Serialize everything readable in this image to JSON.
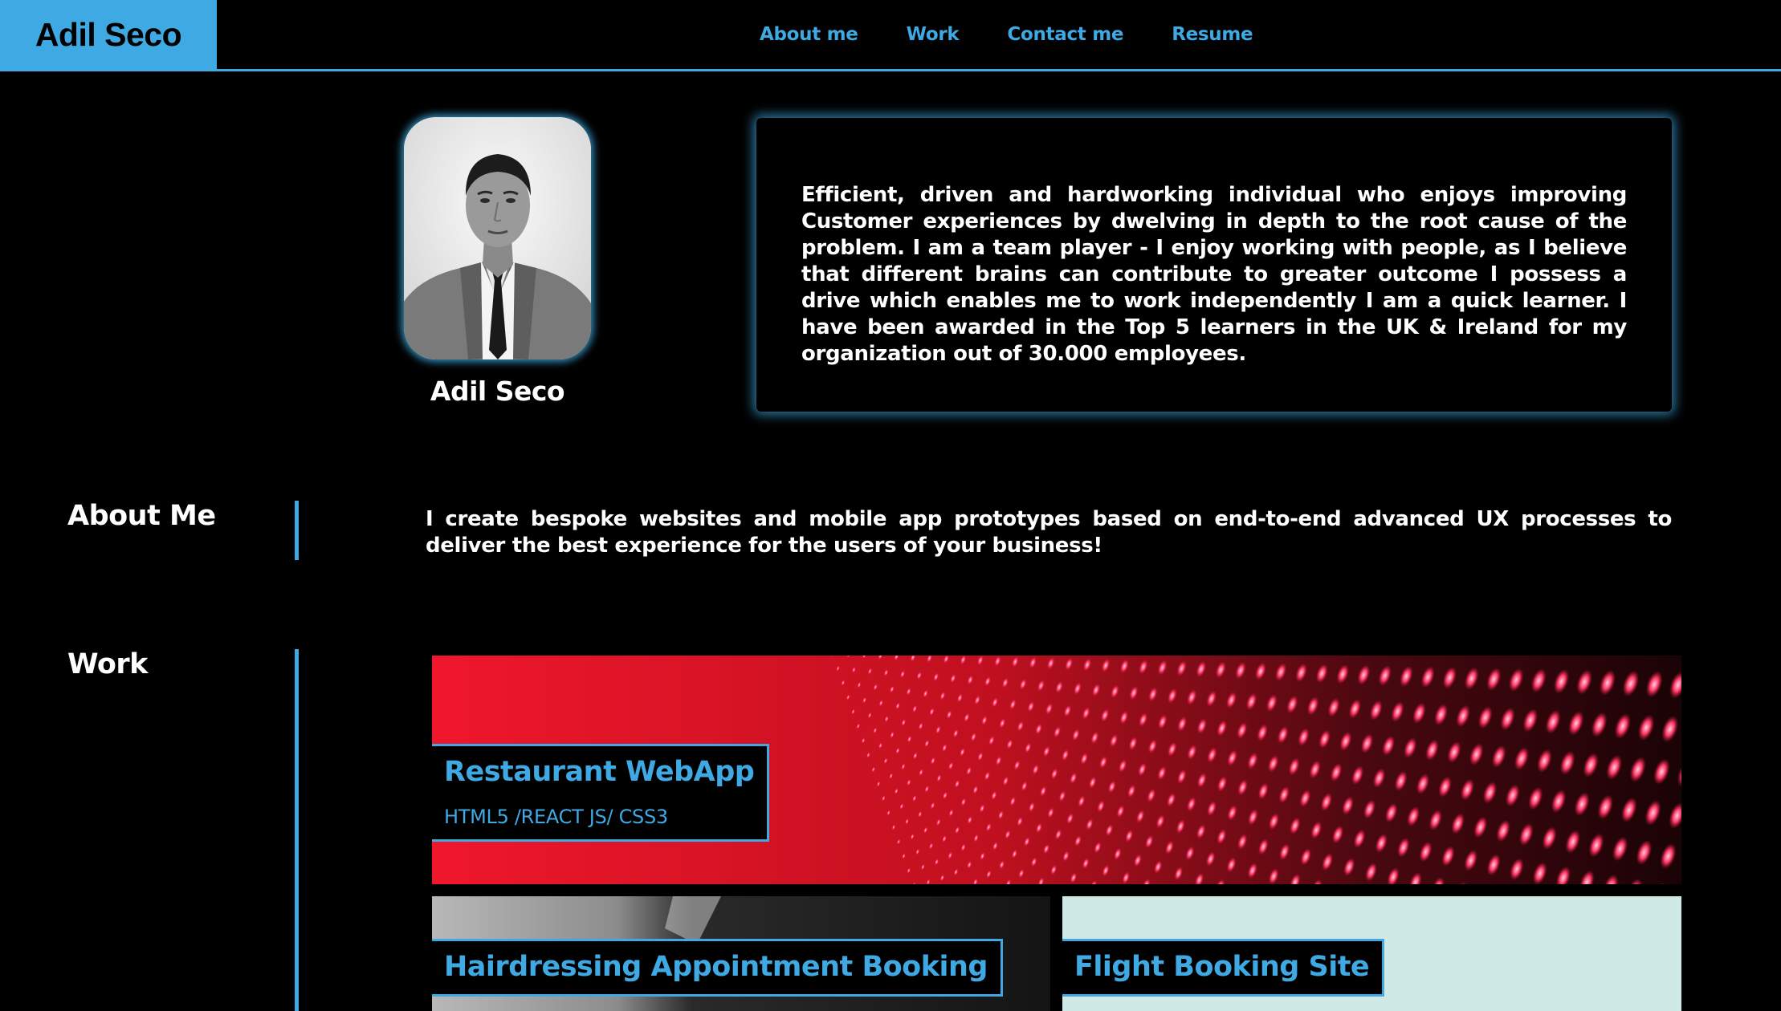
{
  "header": {
    "logo": "Adil Seco",
    "nav": [
      "About me",
      "Work",
      "Contact me",
      "Resume"
    ]
  },
  "profile": {
    "name": "Adil Seco",
    "bio": "Efficient, driven and hardworking individual who enjoys improving Customer experiences by dwelving in depth to the root cause of the problem. I am a team player - I enjoy working with people, as I believe that different brains can contribute to greater outcome I possess a drive which enables me to work independently I am a quick learner. I have been awarded in the Top 5 learners in the UK & Ireland for my organization out of 30.000 employees."
  },
  "about": {
    "title": "About Me",
    "text": "I create bespoke websites and mobile app prototypes based on end-to-end advanced UX processes to deliver the best experience for the users of your business!"
  },
  "work": {
    "title": "Work",
    "projects": [
      {
        "title": "Restaurant WebApp",
        "tech": "HTML5 /REACT JS/ CSS3"
      },
      {
        "title": "Hairdressing Appointment Booking"
      },
      {
        "title": "Flight Booking Site"
      }
    ]
  },
  "colors": {
    "accent": "#3ea9e3",
    "background": "#000000",
    "text": "#ffffff"
  }
}
